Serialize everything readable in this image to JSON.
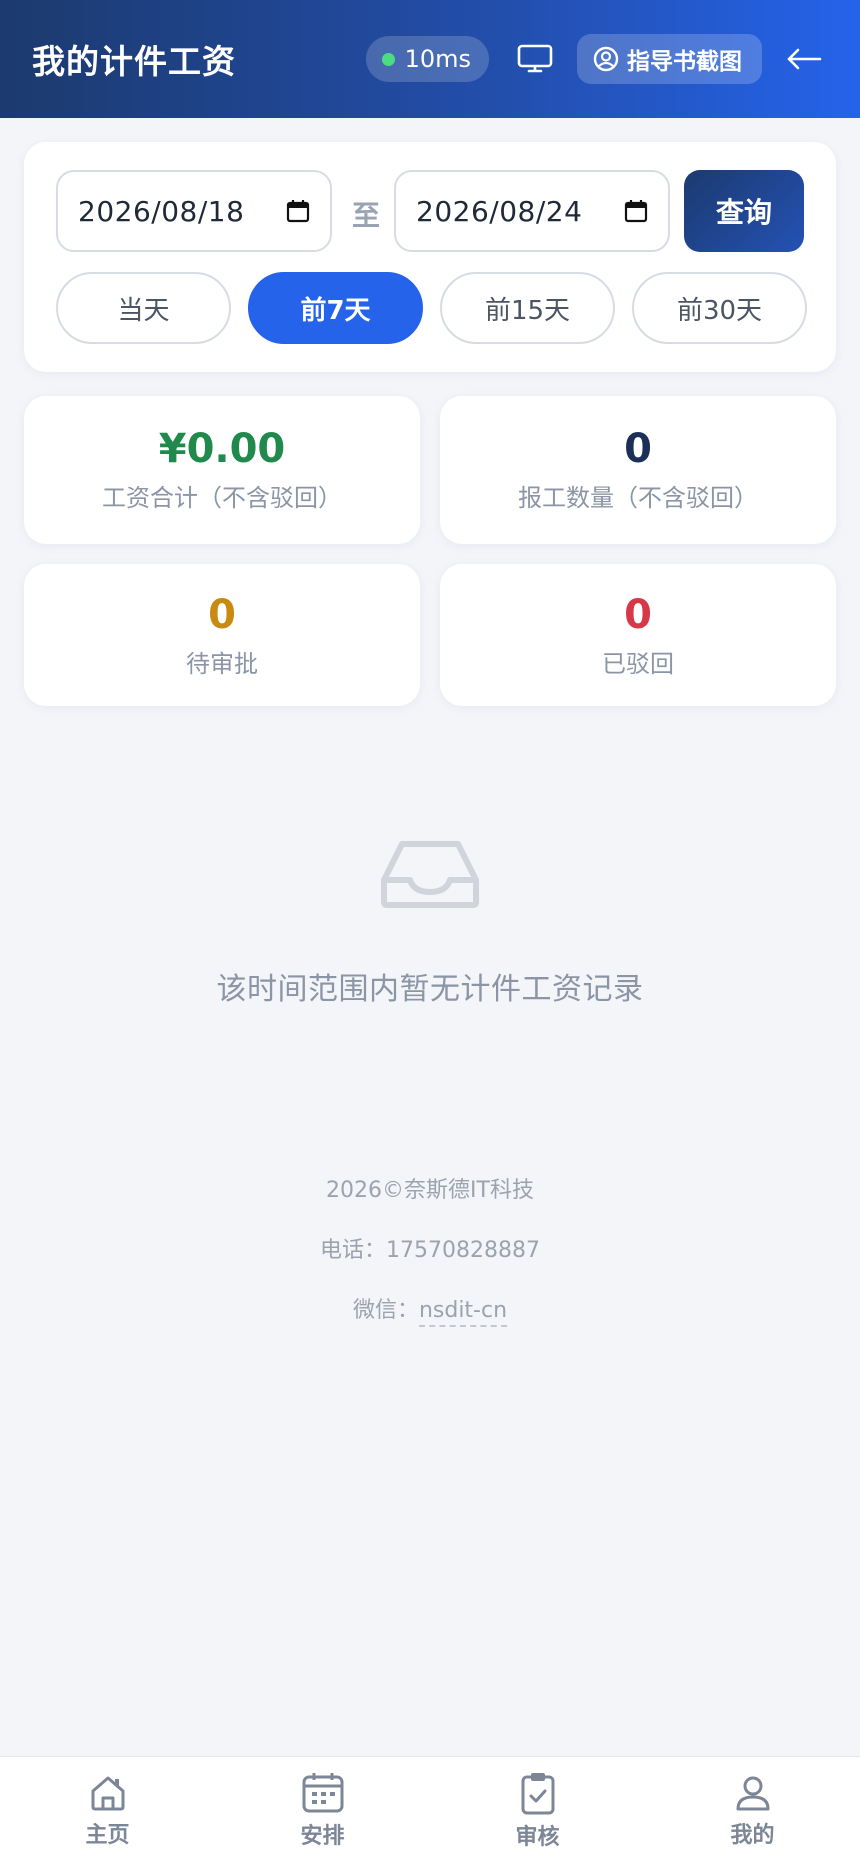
{
  "header": {
    "title": "我的计件工资",
    "ping": "10ms",
    "guide_label": "指导书截图"
  },
  "filter": {
    "start_date": "2026/08/18",
    "end_date": "2026/08/24",
    "to_label": "至",
    "query_label": "查询",
    "ranges": [
      {
        "label": "当天",
        "active": false
      },
      {
        "label": "前7天",
        "active": true
      },
      {
        "label": "前15天",
        "active": false
      },
      {
        "label": "前30天",
        "active": false
      }
    ]
  },
  "stats": [
    {
      "value": "¥0.00",
      "label": "工资合计（不含驳回）",
      "color": "#1f8a4c"
    },
    {
      "value": "0",
      "label": "报工数量（不含驳回）",
      "color": "#1c2f57"
    },
    {
      "value": "0",
      "label": "待审批",
      "color": "#c98a12"
    },
    {
      "value": "0",
      "label": "已驳回",
      "color": "#d63848"
    }
  ],
  "empty": {
    "icon": "inbox-icon",
    "text": "该时间范围内暂无计件工资记录"
  },
  "footer": {
    "copyright": "2026©奈斯德IT科技",
    "phone_label": "电话：",
    "phone": "17570828887",
    "wechat_label": "微信：",
    "wechat": "nsdit-cn"
  },
  "nav": [
    {
      "label": "主页",
      "icon": "home-icon"
    },
    {
      "label": "安排",
      "icon": "calendar-icon"
    },
    {
      "label": "审核",
      "icon": "clipboard-check-icon"
    },
    {
      "label": "我的",
      "icon": "user-icon"
    }
  ],
  "colors": {
    "accent": "#2563eb",
    "header_start": "#1c3a6e"
  }
}
